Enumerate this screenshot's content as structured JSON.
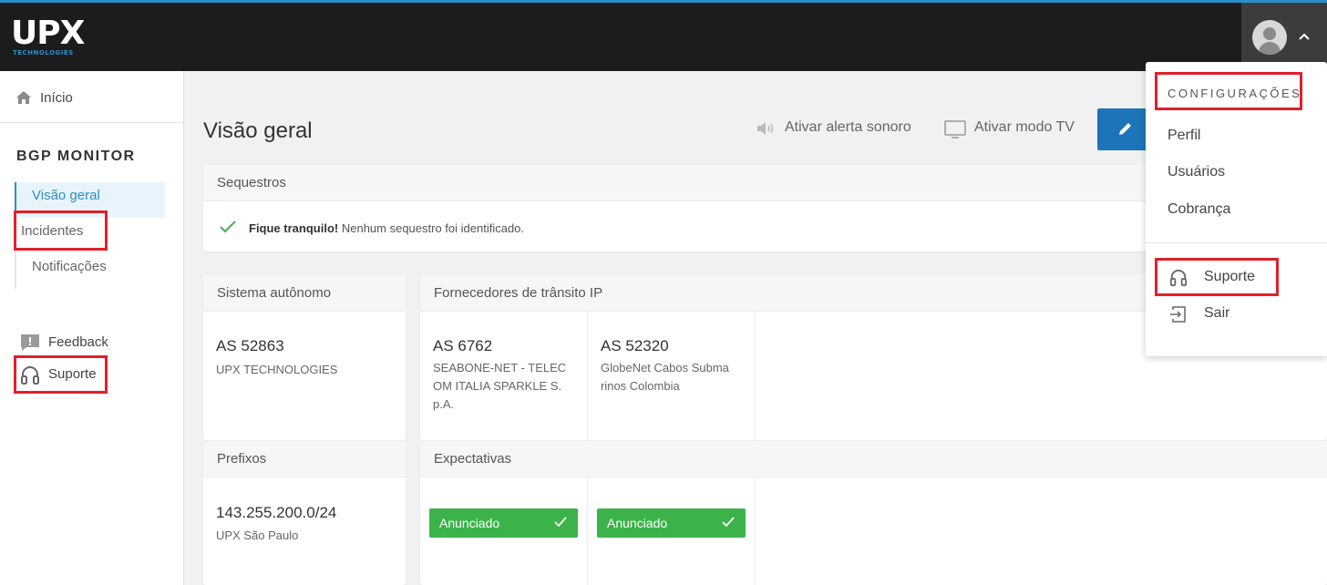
{
  "brand": {
    "logo_text": "UPX",
    "logo_subtext": "TECHNOLOGIES",
    "accent": "#2a8fc8"
  },
  "sidebar": {
    "home_label": "Início",
    "section_title": "BGP MONITOR",
    "nav": [
      {
        "label": "Visão geral",
        "active": true
      },
      {
        "label": "Incidentes",
        "active": false
      },
      {
        "label": "Notificações",
        "active": false
      }
    ],
    "feedback_label": "Feedback",
    "support_label": "Suporte"
  },
  "header": {
    "title": "Visão geral",
    "sound_alert_label": "Ativar alerta sonoro",
    "tv_mode_label": "Ativar modo TV"
  },
  "hijacks": {
    "title": "Sequestros",
    "status_bold": "Fique tranquilo!",
    "status_text": "Nenhum sequestro foi identificado."
  },
  "autonomous_system": {
    "title": "Sistema autônomo",
    "as_number": "AS 52863",
    "as_name": "UPX TECHNOLOGIES"
  },
  "transit_providers": {
    "title": "Fornecedores de trânsito IP",
    "providers": [
      {
        "as_number": "AS 6762",
        "name_lines": [
          "SEABONE-NET - TELEC",
          "OM ITALIA SPARKLE S.",
          "p.A."
        ]
      },
      {
        "as_number": "AS 52320",
        "name_lines": [
          "GlobeNet Cabos Subma",
          "rinos Colombia"
        ]
      }
    ]
  },
  "prefixes": {
    "title": "Prefixos",
    "prefix": "143.255.200.0/24",
    "prefix_name": "UPX São Paulo"
  },
  "expectations": {
    "title": "Expectativas",
    "badges": [
      "Anunciado",
      "Anunciado"
    ],
    "badge_color": "#3bb34a"
  },
  "user_menu": {
    "section_title": "CONFIGURAÇÕES",
    "items": [
      "Perfil",
      "Usuários",
      "Cobrança"
    ],
    "support_label": "Suporte",
    "logout_label": "Sair"
  }
}
